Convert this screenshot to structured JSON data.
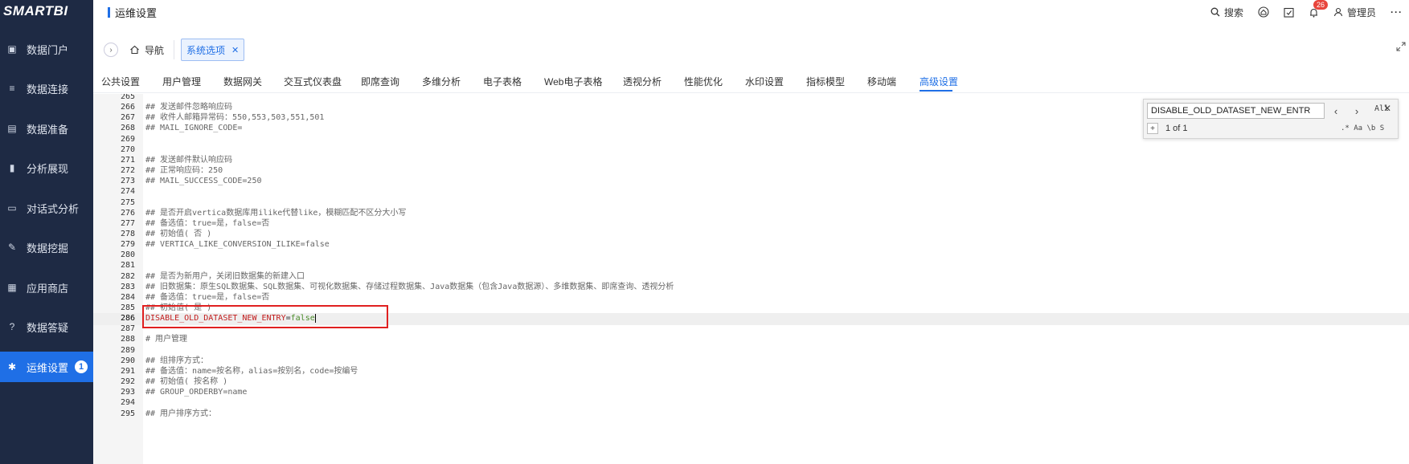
{
  "logo": "SMARTBI",
  "sidebar": {
    "items": [
      {
        "label": "数据门户",
        "icon": "portal-icon"
      },
      {
        "label": "数据连接",
        "icon": "database-icon"
      },
      {
        "label": "数据准备",
        "icon": "prepare-icon"
      },
      {
        "label": "分析展现",
        "icon": "bar-chart-icon"
      },
      {
        "label": "对话式分析",
        "icon": "chat-icon"
      },
      {
        "label": "数据挖掘",
        "icon": "mining-icon"
      },
      {
        "label": "应用商店",
        "icon": "app-store-icon"
      },
      {
        "label": "数据答疑",
        "icon": "question-icon"
      },
      {
        "label": "运维设置",
        "icon": "gear-icon",
        "badge": "1",
        "active": true
      }
    ]
  },
  "header": {
    "title": "运维设置",
    "search_label": "搜索",
    "notification_count": "26",
    "user_label": "管理员"
  },
  "tabbar": {
    "home_label": "导航",
    "open_tab_label": "系统选项"
  },
  "subtabs": {
    "items": [
      "公共设置",
      "用户管理",
      "数据网关",
      "交互式仪表盘",
      "即席查询",
      "多维分析",
      "电子表格",
      "Web电子表格",
      "透视分析",
      "性能优化",
      "水印设置",
      "指标模型",
      "移动端",
      "高级设置"
    ],
    "active": "高级设置"
  },
  "editor": {
    "lines": [
      {
        "n": "265",
        "t": ""
      },
      {
        "n": "266",
        "t": "## 发送邮件忽略响应码"
      },
      {
        "n": "267",
        "t": "## 收件人邮箱异常码：550,553,503,551,501"
      },
      {
        "n": "268",
        "t": "## MAIL_IGNORE_CODE="
      },
      {
        "n": "269",
        "t": ""
      },
      {
        "n": "270",
        "t": ""
      },
      {
        "n": "271",
        "t": "## 发送邮件默认响应码"
      },
      {
        "n": "272",
        "t": "## 正常响应码：250"
      },
      {
        "n": "273",
        "t": "## MAIL_SUCCESS_CODE=250"
      },
      {
        "n": "274",
        "t": ""
      },
      {
        "n": "275",
        "t": ""
      },
      {
        "n": "276",
        "t": "## 是否开启vertica数据库用ilike代替like，模糊匹配不区分大小写"
      },
      {
        "n": "277",
        "t": "## 备选值：true=是，false=否"
      },
      {
        "n": "278",
        "t": "## 初始值( 否 )"
      },
      {
        "n": "279",
        "t": "## VERTICA_LIKE_CONVERSION_ILIKE=false"
      },
      {
        "n": "280",
        "t": ""
      },
      {
        "n": "281",
        "t": ""
      },
      {
        "n": "282",
        "t": "## 是否为新用户，关闭旧数据集的新建入口"
      },
      {
        "n": "283",
        "t": "## 旧数据集：原生SQL数据集、SQL数据集、可视化数据集、存储过程数据集、Java数据集（包含Java数据源）、多维数据集、即席查询、透视分析"
      },
      {
        "n": "284",
        "t": "## 备选值：true=是，false=否"
      },
      {
        "n": "285",
        "t": "## 初始值( 是 )"
      },
      {
        "n": "286",
        "t": "",
        "key": "DISABLE_OLD_DATASET_NEW_ENTRY",
        "eq": "=",
        "val": "false",
        "active": true
      },
      {
        "n": "287",
        "t": ""
      },
      {
        "n": "288",
        "t": "# 用户管理"
      },
      {
        "n": "289",
        "t": ""
      },
      {
        "n": "290",
        "t": "## 组排序方式："
      },
      {
        "n": "291",
        "t": "## 备选值：name=按名称，alias=按别名，code=按编号"
      },
      {
        "n": "292",
        "t": "## 初始值( 按名称 )"
      },
      {
        "n": "293",
        "t": "## GROUP_ORDERBY=name"
      },
      {
        "n": "294",
        "t": ""
      },
      {
        "n": "295",
        "t": "## 用户排序方式："
      }
    ]
  },
  "find": {
    "query": "DISABLE_OLD_DATASET_NEW_ENTR",
    "all_label": "All",
    "count": "1 of 1",
    "options": ".* Aa \\b S"
  },
  "colors": {
    "accent": "#1f6fe6",
    "sidebar_bg": "#1e2a44",
    "highlight_box": "#e02020"
  }
}
